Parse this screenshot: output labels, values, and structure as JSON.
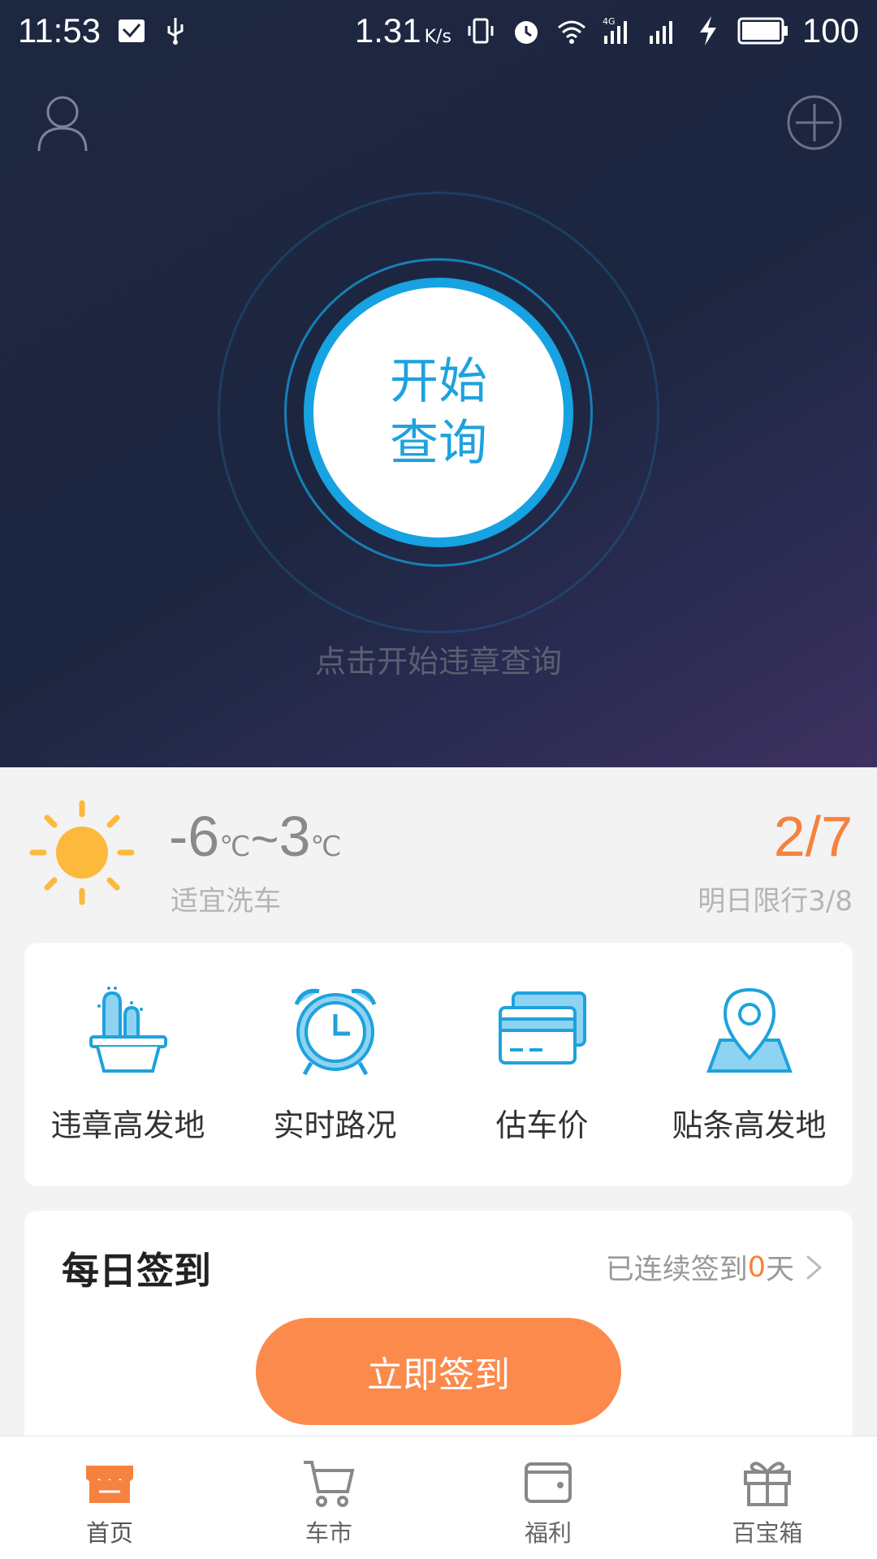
{
  "status_bar": {
    "time": "11:53",
    "speed": "1.31",
    "speed_unit": "K/s",
    "network": "4G",
    "battery": "100"
  },
  "hero": {
    "start_button_line1": "开始",
    "start_button_line2": "查询",
    "hint": "点击开始违章查询"
  },
  "weather": {
    "temp_low": "-6",
    "temp_high": "3",
    "unit": "℃",
    "separator": "~",
    "wash_advice": "适宜洗车",
    "date": "2/7",
    "tomorrow_limit": "明日限行3/8"
  },
  "features": [
    {
      "label": "违章高发地",
      "icon": "cactus-pot-icon"
    },
    {
      "label": "实时路况",
      "icon": "alarm-clock-icon"
    },
    {
      "label": "估车价",
      "icon": "cards-icon"
    },
    {
      "label": "贴条高发地",
      "icon": "map-pin-icon"
    }
  ],
  "checkin": {
    "title": "每日签到",
    "streak_prefix": "已连续签到",
    "streak_days": "0",
    "streak_suffix": "天",
    "button": "立即签到"
  },
  "bottom_nav": [
    {
      "label": "首页",
      "icon": "store-icon",
      "active": true
    },
    {
      "label": "车市",
      "icon": "cart-icon",
      "active": false
    },
    {
      "label": "福利",
      "icon": "wallet-icon",
      "active": false
    },
    {
      "label": "百宝箱",
      "icon": "gift-icon",
      "active": false
    }
  ],
  "colors": {
    "accent_blue": "#17a2e2",
    "accent_orange": "#fb8a4c",
    "hero_bg": "#1e2740"
  }
}
